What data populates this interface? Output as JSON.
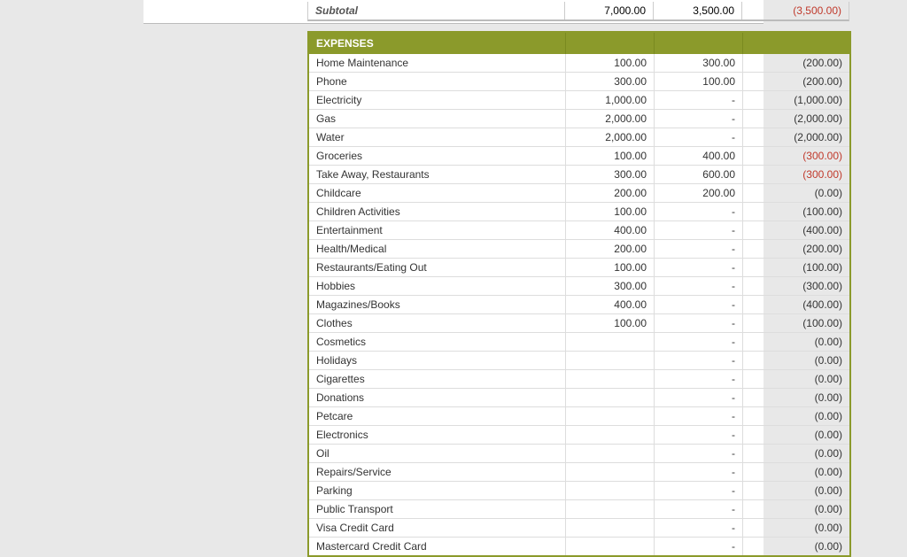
{
  "subtotal": {
    "label": "Subtotal",
    "col1": "7,000.00",
    "col2": "3,500.00",
    "col3": "(3,500.00)"
  },
  "expenses_header": "EXPENSES",
  "rows": [
    {
      "label": "Home Maintenance",
      "col1": "100.00",
      "col2": "300.00",
      "col3": "(200.00)",
      "col3_red": false
    },
    {
      "label": "Phone",
      "col1": "300.00",
      "col2": "100.00",
      "col3": "(200.00)",
      "col3_red": false
    },
    {
      "label": "Electricity",
      "col1": "1,000.00",
      "col2": "-",
      "col3": "(1,000.00)",
      "col3_red": false
    },
    {
      "label": "Gas",
      "col1": "2,000.00",
      "col2": "-",
      "col3": "(2,000.00)",
      "col3_red": false
    },
    {
      "label": "Water",
      "col1": "2,000.00",
      "col2": "-",
      "col3": "(2,000.00)",
      "col3_red": false
    },
    {
      "label": "Groceries",
      "col1": "100.00",
      "col2": "400.00",
      "col3": "(300.00)",
      "col3_red": true
    },
    {
      "label": "Take Away, Restaurants",
      "col1": "300.00",
      "col2": "600.00",
      "col3": "(300.00)",
      "col3_red": true
    },
    {
      "label": "Childcare",
      "col1": "200.00",
      "col2": "200.00",
      "col3": "(0.00)",
      "col3_red": false
    },
    {
      "label": "Children Activities",
      "col1": "100.00",
      "col2": "-",
      "col3": "(100.00)",
      "col3_red": false
    },
    {
      "label": "Entertainment",
      "col1": "400.00",
      "col2": "-",
      "col3": "(400.00)",
      "col3_red": false
    },
    {
      "label": "Health/Medical",
      "col1": "200.00",
      "col2": "-",
      "col3": "(200.00)",
      "col3_red": false
    },
    {
      "label": "Restaurants/Eating Out",
      "col1": "100.00",
      "col2": "-",
      "col3": "(100.00)",
      "col3_red": false
    },
    {
      "label": "Hobbies",
      "col1": "300.00",
      "col2": "-",
      "col3": "(300.00)",
      "col3_red": false
    },
    {
      "label": "Magazines/Books",
      "col1": "400.00",
      "col2": "-",
      "col3": "(400.00)",
      "col3_red": false
    },
    {
      "label": "Clothes",
      "col1": "100.00",
      "col2": "-",
      "col3": "(100.00)",
      "col3_red": false
    },
    {
      "label": "Cosmetics",
      "col1": "",
      "col2": "-",
      "col3": "(0.00)",
      "col3_red": false
    },
    {
      "label": "Holidays",
      "col1": "",
      "col2": "-",
      "col3": "(0.00)",
      "col3_red": false
    },
    {
      "label": "Cigarettes",
      "col1": "",
      "col2": "-",
      "col3": "(0.00)",
      "col3_red": false
    },
    {
      "label": "Donations",
      "col1": "",
      "col2": "-",
      "col3": "(0.00)",
      "col3_red": false
    },
    {
      "label": "Petcare",
      "col1": "",
      "col2": "-",
      "col3": "(0.00)",
      "col3_red": false
    },
    {
      "label": "Electronics",
      "col1": "",
      "col2": "-",
      "col3": "(0.00)",
      "col3_red": false
    },
    {
      "label": "Oil",
      "col1": "",
      "col2": "-",
      "col3": "(0.00)",
      "col3_red": false
    },
    {
      "label": "Repairs/Service",
      "col1": "",
      "col2": "-",
      "col3": "(0.00)",
      "col3_red": false
    },
    {
      "label": "Parking",
      "col1": "",
      "col2": "-",
      "col3": "(0.00)",
      "col3_red": false
    },
    {
      "label": "Public Transport",
      "col1": "",
      "col2": "-",
      "col3": "(0.00)",
      "col3_red": false
    },
    {
      "label": "Visa Credit Card",
      "col1": "",
      "col2": "-",
      "col3": "(0.00)",
      "col3_red": false
    },
    {
      "label": "Mastercard Credit Card",
      "col1": "",
      "col2": "-",
      "col3": "(0.00)",
      "col3_red": false
    }
  ]
}
